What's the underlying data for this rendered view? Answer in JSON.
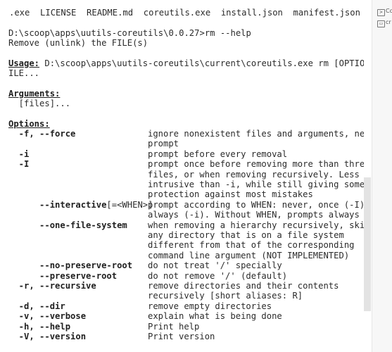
{
  "files_listing": ".exe  LICENSE  README.md  coreutils.exe  install.json  manifest.json",
  "prompt": "D:\\scoop\\apps\\uutils-coreutils\\0.0.27>rm --help",
  "description": "Remove (unlink) the FILE(s)",
  "usage": {
    "label": "Usage:",
    "text": " D:\\scoop\\apps\\uutils-coreutils\\current\\coreutils.exe rm [OPTION]... F",
    "wrap": "ILE..."
  },
  "arguments": {
    "label": "Arguments:",
    "item": "  [files]..."
  },
  "options": {
    "label": "Options:",
    "rows": [
      {
        "flag": "  -f, --force",
        "desc": "ignore nonexistent files and arguments, never"
      },
      {
        "flag": "",
        "desc": "prompt"
      },
      {
        "flag": "  -i",
        "desc": "prompt before every removal"
      },
      {
        "flag": "  -I",
        "desc": "prompt once before removing more than three"
      },
      {
        "flag": "",
        "desc": "files, or when removing recursively. Less"
      },
      {
        "flag": "",
        "desc": "intrusive than -i, while still giving some"
      },
      {
        "flag": "",
        "desc": "protection against most mistakes"
      },
      {
        "flag": "      --interactive",
        "flag_extra": "[=<WHEN>]",
        "desc": "prompt according to WHEN: never, once (-I), or"
      },
      {
        "flag": "",
        "desc": "always (-i). Without WHEN, prompts always"
      },
      {
        "flag": "      --one-file-system",
        "desc": "when removing a hierarchy recursively, skip"
      },
      {
        "flag": "",
        "desc": "any directory that is on a file system"
      },
      {
        "flag": "",
        "desc": "different from that of the corresponding"
      },
      {
        "flag": "",
        "desc": "command line argument (NOT IMPLEMENTED)"
      },
      {
        "flag": "      --no-preserve-root",
        "desc": "do not treat '/' specially"
      },
      {
        "flag": "      --preserve-root",
        "desc": "do not remove '/' (default)"
      },
      {
        "flag": "  -r, --recursive",
        "desc": "remove directories and their contents"
      },
      {
        "flag": "",
        "desc": "recursively [short aliases: R]"
      },
      {
        "flag": "  -d, --dir",
        "desc": "remove empty directories"
      },
      {
        "flag": "  -v, --verbose",
        "desc": "explain what is being done"
      },
      {
        "flag": "  -h, --help",
        "desc": "Print help"
      },
      {
        "flag": "  -V, --version",
        "desc": "Print version"
      }
    ]
  },
  "side_panel": {
    "items": [
      "Co",
      "cr"
    ]
  }
}
